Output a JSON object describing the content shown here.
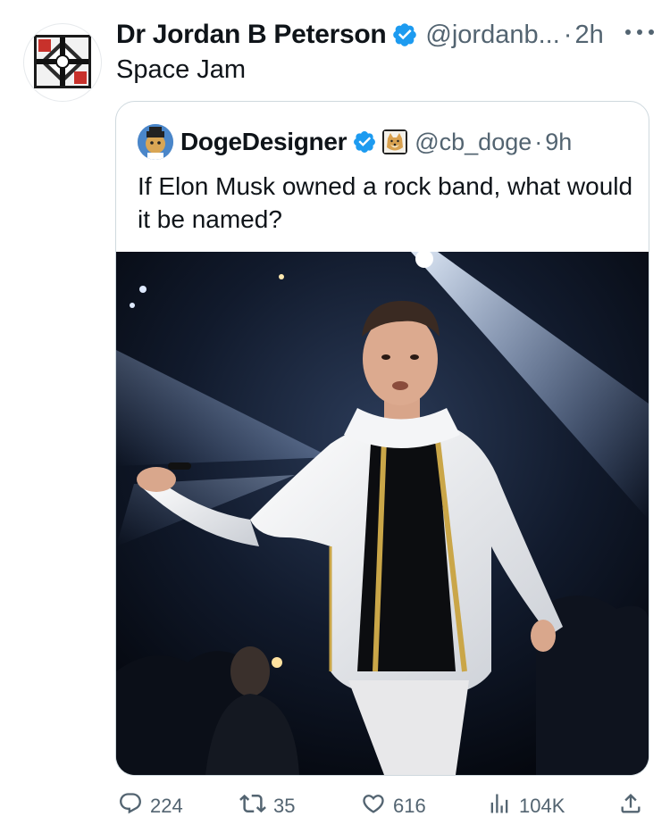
{
  "tweet": {
    "author_name": "Dr Jordan B Peterson",
    "handle": "@jordanb...",
    "separator": "·",
    "time": "2h",
    "text": "Space Jam"
  },
  "quoted": {
    "author_name": "DogeDesigner",
    "handle": "@cb_doge",
    "separator": "·",
    "time": "9h",
    "text": "If Elon Musk owned a rock band, what would it be named?"
  },
  "actions": {
    "replies": "224",
    "retweets": "35",
    "likes": "616",
    "views": "104K"
  },
  "colors": {
    "verified_blue": "#1d9bf0",
    "secondary_text": "#536471",
    "border": "#cfd9de"
  },
  "icons": [
    "verified-badge-icon",
    "more-options-icon",
    "reply-icon",
    "retweet-icon",
    "like-icon",
    "views-icon",
    "share-icon"
  ]
}
